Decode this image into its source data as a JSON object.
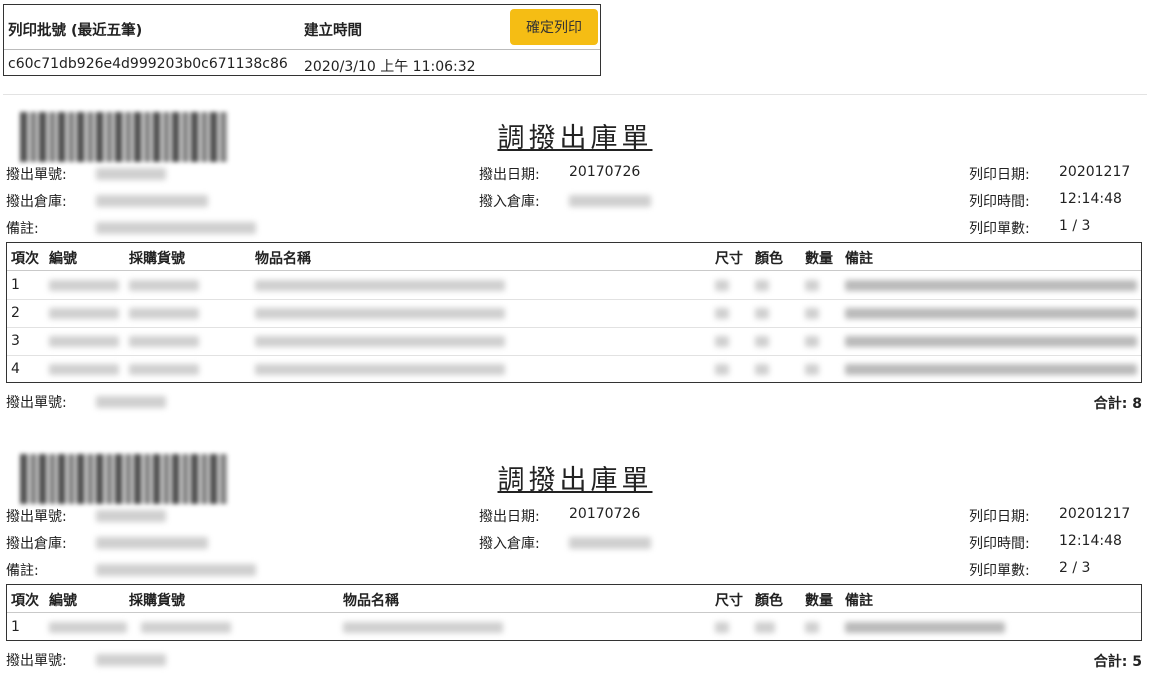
{
  "batch": {
    "col_batch_label": "列印批號 (最近五筆)",
    "col_time_label": "建立時間",
    "confirm_label": "確定列印",
    "batch_id": "c60c71db926e4d999203b0c671138c86",
    "created_at": "2020/3/10 上午 11:06:32"
  },
  "labels": {
    "title": "調撥出庫單",
    "out_no": "撥出單號:",
    "out_warehouse": "撥出倉庫:",
    "remark": "備註:",
    "out_date": "撥出日期:",
    "in_warehouse": "撥入倉庫:",
    "print_date": "列印日期:",
    "print_time": "列印時間:",
    "print_count": "列印單數:",
    "col_seq": "項次",
    "col_code": "編號",
    "col_purchase": "採購貨號",
    "col_name": "物品名稱",
    "col_size": "尺寸",
    "col_color": "顏色",
    "col_qty": "數量",
    "col_remark": "備註",
    "total": "合計:"
  },
  "docs": [
    {
      "out_date": "20170726",
      "print_date": "20201217",
      "print_time": "12:14:48",
      "print_count": "1 / 3",
      "rows": [
        "1",
        "2",
        "3",
        "4"
      ],
      "total": "8"
    },
    {
      "out_date": "20170726",
      "print_date": "20201217",
      "print_time": "12:14:48",
      "print_count": "2 / 3",
      "rows": [
        "1"
      ],
      "total": "5"
    }
  ]
}
